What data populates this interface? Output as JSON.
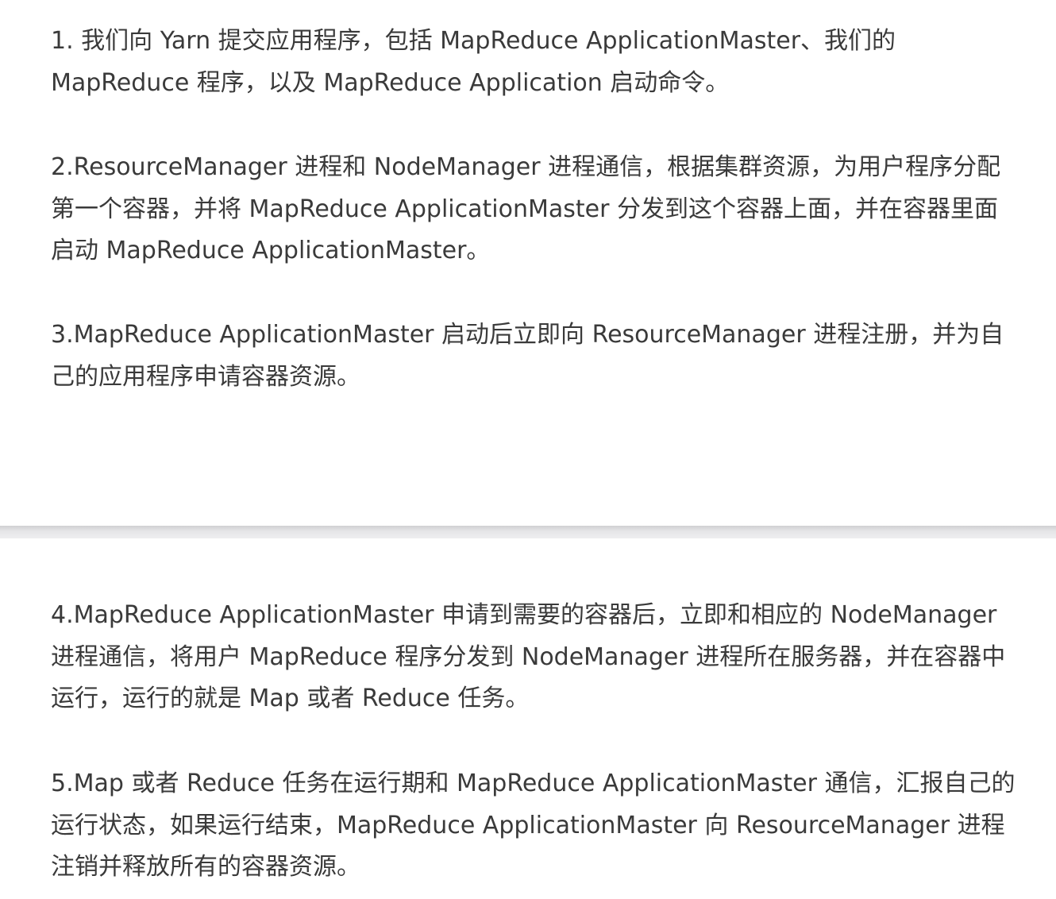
{
  "steps": [
    {
      "lines": [
        "1. 我们向 Yarn 提交应用程序，包括 MapReduce ApplicationMaster、我们的",
        "MapReduce 程序，以及 MapReduce Application 启动命令。"
      ]
    },
    {
      "lines": [
        "2.ResourceManager 进程和 NodeManager 进程通信，根据集群资源，为用户程序分配",
        "第一个容器，并将 MapReduce ApplicationMaster 分发到这个容器上面，并在容器里面",
        "启动 MapReduce ApplicationMaster。"
      ]
    },
    {
      "lines": [
        "3.MapReduce ApplicationMaster 启动后立即向 ResourceManager 进程注册，并为自",
        "己的应用程序申请容器资源。"
      ]
    },
    {
      "lines": [
        "4.MapReduce ApplicationMaster 申请到需要的容器后，立即和相应的 NodeManager",
        "进程通信，将用户 MapReduce 程序分发到 NodeManager 进程所在服务器，并在容器中",
        "运行，运行的就是 Map 或者 Reduce 任务。"
      ]
    },
    {
      "lines": [
        "5.Map 或者 Reduce 任务在运行期和 MapReduce ApplicationMaster 通信，汇报自己的",
        "运行状态，如果运行结束，MapReduce ApplicationMaster 向 ResourceManager 进程",
        "注销并释放所有的容器资源。"
      ]
    }
  ]
}
